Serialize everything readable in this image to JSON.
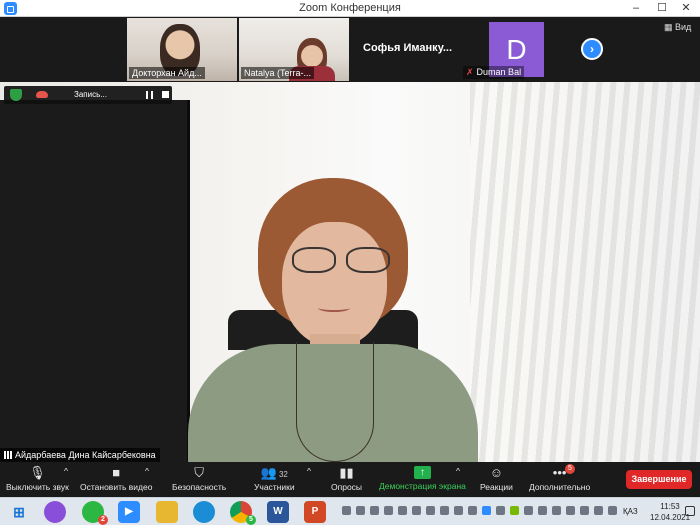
{
  "window": {
    "title": "Zoom Конференция",
    "minimize": "–",
    "maximize": "☐",
    "close": "✕"
  },
  "gallery": {
    "participants": [
      {
        "name": "Докторхан Айд..."
      },
      {
        "name": "Natalya (Terra-..."
      },
      {
        "name": "Софья  Иманку..."
      },
      {
        "name": "Duman Bal",
        "avatar_letter": "D",
        "avatar_color": "#8b5bd6",
        "muted": true
      }
    ],
    "next_label": "›",
    "view_label": "Вид"
  },
  "recording": {
    "label": "Запись..."
  },
  "active_speaker": {
    "name": "Айдарбаева Дина Кайсарбековна"
  },
  "toolbar": {
    "mute": "Выключить звук",
    "video": "Остановить видео",
    "security": "Безопасность",
    "participants": "Участники",
    "participants_count": "32",
    "polls": "Опросы",
    "share": "Демонстрация экрана",
    "reactions": "Реакции",
    "more": "Дополнительно",
    "more_badge": "5",
    "end": "Завершение"
  },
  "taskbar": {
    "whatsapp_badge": "2",
    "chrome_badge": "5",
    "word_label": "W",
    "powerpoint_label": "P",
    "language": "ҚАЗ",
    "time": "11:53",
    "date": "12.04.2021"
  },
  "colors": {
    "accent": "#2d8cff",
    "end": "#e02828",
    "share": "#22b14c",
    "toolbar_bg": "#1a1a1a"
  }
}
